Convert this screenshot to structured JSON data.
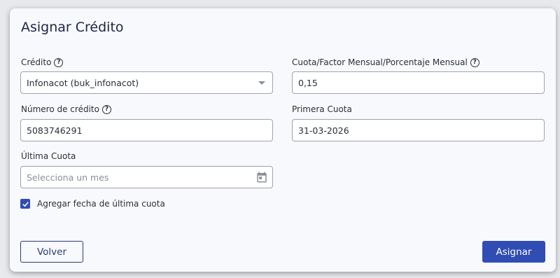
{
  "dialog": {
    "title": "Asignar Crédito"
  },
  "form": {
    "credito": {
      "label": "Crédito",
      "value": "Infonacot (buk_infonacot)"
    },
    "cuota_factor": {
      "label": "Cuota/Factor Mensual/Porcentaje Mensual",
      "value": "0,15"
    },
    "numero_credito": {
      "label": "Número de crédito",
      "value": "5083746291"
    },
    "primera_cuota": {
      "label": "Primera Cuota",
      "value": "31-03-2026"
    },
    "ultima_cuota": {
      "label": "Última Cuota",
      "placeholder": "Selecciona un mes"
    },
    "agregar_fecha": {
      "label": "Agregar fecha de última cuota",
      "checked": true
    }
  },
  "actions": {
    "cancel_label": "Volver",
    "submit_label": "Asignar"
  },
  "colors": {
    "primary": "#2f4db3",
    "title": "#1c2545"
  },
  "icons": {
    "help": "question-circle-icon",
    "calendar": "calendar-icon",
    "dropdown": "caret-down-icon",
    "check": "checkmark-icon"
  }
}
